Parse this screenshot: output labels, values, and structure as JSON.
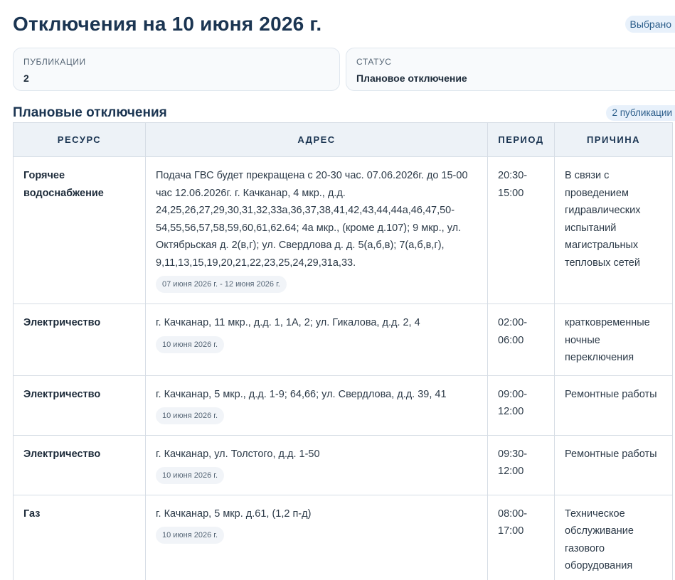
{
  "header": {
    "title": "Отключения на 10 июня 2026 г.",
    "selected_label": "Выбрано"
  },
  "summary": {
    "publications": {
      "label": "ПУБЛИКАЦИИ",
      "value": "2"
    },
    "status": {
      "label": "СТАТУС",
      "value": "Плановое отключение"
    }
  },
  "section": {
    "title": "Плановые отключения",
    "count_label": "2 публикации"
  },
  "table": {
    "columns": [
      "РЕСУРС",
      "АДРЕС",
      "ПЕРИОД",
      "ПРИЧИНА"
    ],
    "rows": [
      {
        "resource": "Горячее водоснабжение",
        "address": "Подача ГВС будет прекращена с 20-30 час. 07.06.2026г. до 15-00 час 12.06.2026г. г. Качканар, 4 мкр., д.д. 24,25,26,27,29,30,31,32,33а,36,37,38,41,42,43,44,44а,46,47,50-54,55,56,57,58,59,60,61,62.64; 4а мкр., (кроме д.107); 9 мкр., ул. Октябрьская д. 2(в,г); ул. Свердлова д. д. 5(а,б,в); 7(а,б,в,г), 9,11,13,15,19,20,21,22,23,25,24,29,31а,33.",
        "dates": "07 июня 2026 г. - 12 июня 2026 г.",
        "period": "20:30-15:00",
        "reason": "В связи с проведением гидравлических испытаний магистральных тепловых сетей"
      },
      {
        "resource": "Электричество",
        "address": "г. Качканар, 11 мкр., д.д. 1, 1А, 2; ул. Гикалова, д.д. 2, 4",
        "dates": "10 июня 2026 г.",
        "period": "02:00-06:00",
        "reason": "кратковременные ночные переключения"
      },
      {
        "resource": "Электричество",
        "address": "г. Качканар, 5 мкр., д.д. 1-9; 64,66; ул. Свердлова, д.д. 39, 41",
        "dates": "10 июня 2026 г.",
        "period": "09:00-12:00",
        "reason": "Ремонтные работы"
      },
      {
        "resource": "Электричество",
        "address": "г. Качканар, ул. Толстого, д.д. 1-50",
        "dates": "10 июня 2026 г.",
        "period": "09:30-12:00",
        "reason": "Ремонтные работы"
      },
      {
        "resource": "Газ",
        "address": "г. Качканар, 5 мкр. д.61, (1,2 п-д)",
        "dates": "10 июня 2026 г.",
        "period": "08:00-17:00",
        "reason": "Техническое обслуживание газового оборудования"
      }
    ]
  }
}
